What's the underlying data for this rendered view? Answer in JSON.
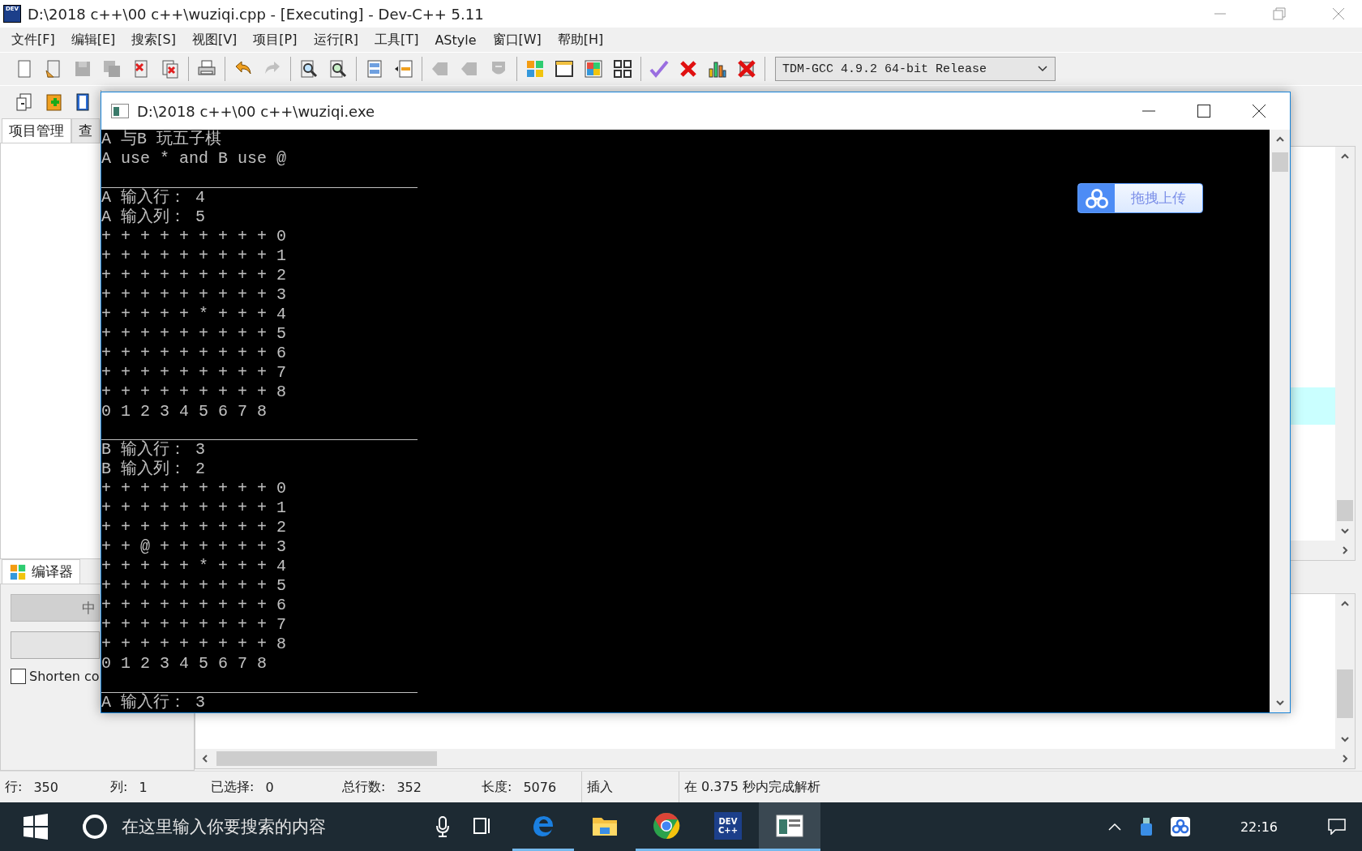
{
  "ide": {
    "icon_text": "DEV",
    "title": "D:\\2018 c++\\00 c++\\wuziqi.cpp - [Executing] - Dev-C++ 5.11",
    "menu": [
      "文件[F]",
      "编辑[E]",
      "搜索[S]",
      "视图[V]",
      "项目[P]",
      "运行[R]",
      "工具[T]",
      "AStyle",
      "窗口[W]",
      "帮助[H]"
    ],
    "toolbar": [
      [
        {
          "kind": "new",
          "disabled": false
        },
        {
          "kind": "open",
          "disabled": false
        },
        {
          "kind": "save",
          "disabled": true
        },
        {
          "kind": "save-all",
          "disabled": true
        },
        {
          "kind": "close",
          "disabled": false
        },
        {
          "kind": "close-all",
          "disabled": false
        }
      ],
      [
        {
          "kind": "print",
          "disabled": false
        }
      ],
      [
        {
          "kind": "undo",
          "disabled": false
        },
        {
          "kind": "redo",
          "disabled": true
        }
      ],
      [
        {
          "kind": "find",
          "disabled": false
        },
        {
          "kind": "replace",
          "disabled": false
        }
      ],
      [
        {
          "kind": "indent",
          "disabled": false
        },
        {
          "kind": "unindent",
          "disabled": false
        }
      ],
      [
        {
          "kind": "back",
          "disabled": true
        },
        {
          "kind": "forward",
          "disabled": true
        },
        {
          "kind": "bookmark",
          "disabled": true
        }
      ],
      [
        {
          "kind": "grid",
          "disabled": false
        },
        {
          "kind": "window",
          "disabled": false
        },
        {
          "kind": "tiles",
          "disabled": false
        },
        {
          "kind": "squares",
          "disabled": false
        }
      ],
      [
        {
          "kind": "check",
          "disabled": false
        },
        {
          "kind": "stop",
          "disabled": false
        },
        {
          "kind": "chart",
          "disabled": false
        },
        {
          "kind": "delete",
          "disabled": false
        }
      ]
    ],
    "compiler": "TDM-GCC 4.9.2 64-bit Release",
    "toolbar2": [
      {
        "kind": "goto",
        "disabled": false
      },
      {
        "kind": "add",
        "disabled": false
      },
      {
        "kind": "book",
        "disabled": false
      }
    ],
    "left_tabs": [
      {
        "label": "项目管理",
        "selected": true
      },
      {
        "label": "查",
        "selected": false
      }
    ],
    "bottom_tabs": [
      {
        "label": "编译器",
        "selected": true
      }
    ],
    "compiler_button": "中",
    "checkbox": {
      "label": "Shorten co",
      "checked": false
    },
    "status": [
      {
        "label": "行:",
        "value": "350"
      },
      {
        "label": "列:",
        "value": "1"
      },
      {
        "label": "已选择:",
        "value": "0"
      },
      {
        "label": "总行数:",
        "value": "352"
      },
      {
        "label": "长度:",
        "value": "5076"
      },
      {
        "label": "插入"
      },
      {
        "label": "在 0.375 秒内完成解析"
      }
    ]
  },
  "console": {
    "title": "D:\\2018 c++\\00 c++\\wuziqi.exe",
    "lines": [
      {
        "kind": "text",
        "text": "A 与B 玩五子棋"
      },
      {
        "kind": "text",
        "text": "A use * and B use @"
      },
      {
        "kind": "rule"
      },
      {
        "kind": "text",
        "text": "A 输入行： 4"
      },
      {
        "kind": "text",
        "text": "A 输入列： 5"
      },
      {
        "kind": "text",
        "text": "+ + + + + + + + + 0"
      },
      {
        "kind": "text",
        "text": "+ + + + + + + + + 1"
      },
      {
        "kind": "text",
        "text": "+ + + + + + + + + 2"
      },
      {
        "kind": "text",
        "text": "+ + + + + + + + + 3"
      },
      {
        "kind": "text",
        "text": "+ + + + + * + + + 4"
      },
      {
        "kind": "text",
        "text": "+ + + + + + + + + 5"
      },
      {
        "kind": "text",
        "text": "+ + + + + + + + + 6"
      },
      {
        "kind": "text",
        "text": "+ + + + + + + + + 7"
      },
      {
        "kind": "text",
        "text": "+ + + + + + + + + 8"
      },
      {
        "kind": "text",
        "text": "0 1 2 3 4 5 6 7 8"
      },
      {
        "kind": "rule"
      },
      {
        "kind": "text",
        "text": "B 输入行： 3"
      },
      {
        "kind": "text",
        "text": "B 输入列： 2"
      },
      {
        "kind": "text",
        "text": "+ + + + + + + + + 0"
      },
      {
        "kind": "text",
        "text": "+ + + + + + + + + 1"
      },
      {
        "kind": "text",
        "text": "+ + + + + + + + + 2"
      },
      {
        "kind": "text",
        "text": "+ + @ + + + + + + 3"
      },
      {
        "kind": "text",
        "text": "+ + + + + * + + + 4"
      },
      {
        "kind": "text",
        "text": "+ + + + + + + + + 5"
      },
      {
        "kind": "text",
        "text": "+ + + + + + + + + 6"
      },
      {
        "kind": "text",
        "text": "+ + + + + + + + + 7"
      },
      {
        "kind": "text",
        "text": "+ + + + + + + + + 8"
      },
      {
        "kind": "text",
        "text": "0 1 2 3 4 5 6 7 8"
      },
      {
        "kind": "rule"
      },
      {
        "kind": "text",
        "text": "A 输入行： 3"
      }
    ]
  },
  "upload_button": {
    "label": "拖拽上传"
  },
  "taskbar": {
    "search": {
      "placeholder": "在这里输入你要搜索的内容"
    },
    "apps": [
      {
        "kind": "taskview",
        "running": false,
        "active": false
      },
      {
        "kind": "edge",
        "running": true,
        "active": false
      },
      {
        "kind": "explorer",
        "running": false,
        "active": false
      },
      {
        "kind": "chrome",
        "running": true,
        "active": false
      },
      {
        "kind": "devcpp",
        "text": [
          "DEV",
          "C++"
        ],
        "running": true,
        "active": false
      },
      {
        "kind": "console",
        "running": true,
        "active": true
      }
    ],
    "clock": "22:16"
  }
}
